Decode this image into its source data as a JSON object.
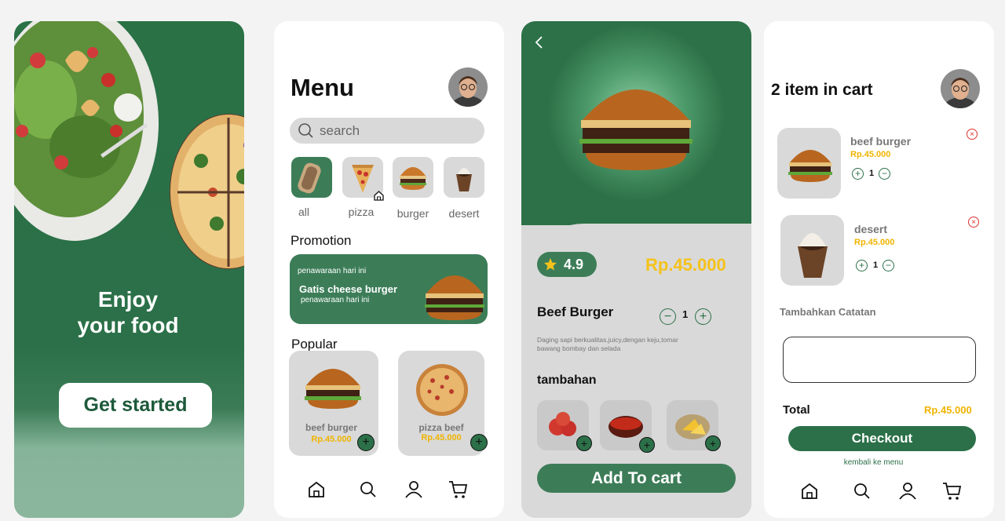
{
  "colors": {
    "green": "#2b7048",
    "green_light": "#3c7d58",
    "accent_yellow": "#f5c21b",
    "grey_card": "#d9d9d9",
    "remove_red": "#dd3333"
  },
  "screen1": {
    "title_line1": "Enjoy",
    "title_line2": "your food",
    "get_started": "Get started"
  },
  "screen2": {
    "title": "Menu",
    "search_placeholder": "search",
    "categories": [
      {
        "label": "all",
        "icon": "all-food-icon"
      },
      {
        "label": "pizza",
        "icon": "pizza-icon"
      },
      {
        "label": "burger",
        "icon": "burger-icon"
      },
      {
        "label": "desert",
        "icon": "dessert-icon"
      }
    ],
    "promotion_heading": "Promotion",
    "promo": {
      "small_top": "penawaraan hari ini",
      "title": "Gatis cheese burger",
      "small_bottom": "penawaraan hari ini"
    },
    "popular_heading": "Popular",
    "popular": [
      {
        "name": "beef burger",
        "price": "Rp.45.000"
      },
      {
        "name": "pizza beef",
        "price": "Rp.45.000"
      }
    ],
    "nav": [
      "home-icon",
      "search-icon",
      "profile-icon",
      "cart-icon"
    ]
  },
  "screen3": {
    "rating": "4.9",
    "price": "Rp.45.000",
    "name": "Beef Burger",
    "quantity": "1",
    "description": "Daging sapi berkualitas,juicy,dengan keju,tomar bawang bombay dan selada",
    "extras_heading": "tambahan",
    "extras": [
      "tomato",
      "sauce",
      "cheese"
    ],
    "add_to_cart": "Add To cart"
  },
  "screen4": {
    "title": "2 item in cart",
    "items": [
      {
        "name": "beef burger",
        "price": "Rp.45.000",
        "qty": "1"
      },
      {
        "name": "desert",
        "price": "Rp.45.000",
        "qty": "1"
      }
    ],
    "note_label": "Tambahkan Catatan",
    "total_label": "Total",
    "total_value": "Rp.45.000",
    "checkout": "Checkout",
    "back_link": "kembali ke menu"
  }
}
